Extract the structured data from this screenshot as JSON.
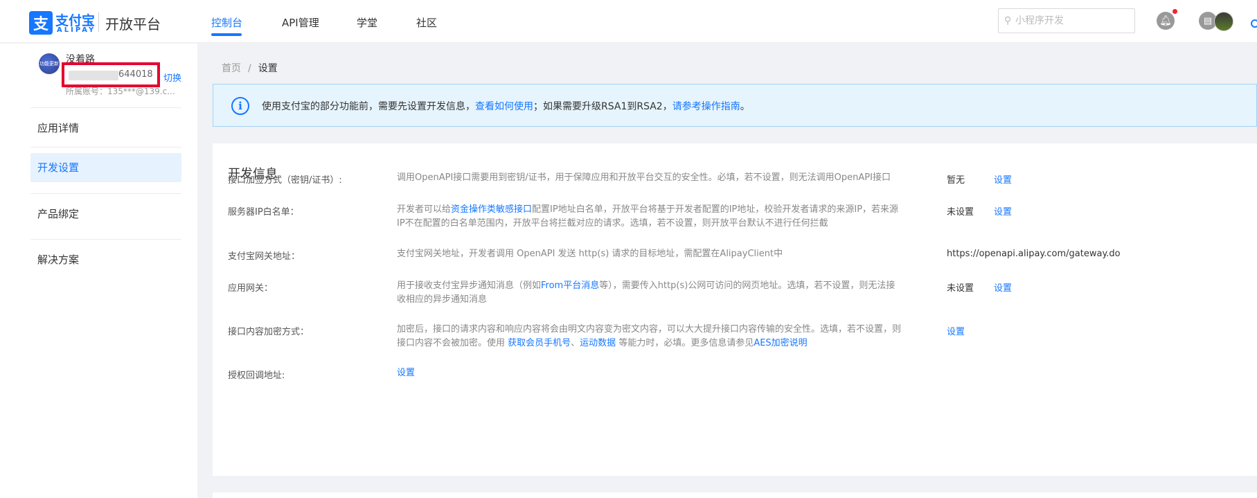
{
  "header": {
    "logo_glyph": "支",
    "logo_cn": "支付宝",
    "logo_en": "ALIPAY",
    "logo_sub": "开放平台",
    "tabs": [
      {
        "label": "控制台",
        "active": true
      },
      {
        "label": "API管理",
        "active": false
      },
      {
        "label": "学堂",
        "active": false
      },
      {
        "label": "社区",
        "active": false
      }
    ],
    "search": {
      "placeholder": "小程序开发",
      "value": ""
    },
    "accent_color": "#1677ff"
  },
  "sidebar": {
    "avatar_text": "功能更新",
    "app_name": "没着路",
    "app_id_suffix": "644018",
    "switch_label": "切换",
    "account_label": "所属账号：135***@139.c...",
    "items": [
      {
        "label": "应用详情",
        "active": false
      },
      {
        "label": "开发设置",
        "active": true
      },
      {
        "label": "产品绑定",
        "active": false
      },
      {
        "label": "解决方案",
        "active": false
      }
    ]
  },
  "breadcrumb": {
    "home": "首页",
    "separator": "/",
    "current": "设置"
  },
  "alert": {
    "icon": "i",
    "text1": "使用支付宝的部分功能前，需要先设置开发信息，",
    "link1": "查看如何使用",
    "text2": "；如果需要升级RSA1到RSA2，",
    "link2": "请参考操作指南",
    "text3": "。"
  },
  "dev_info": {
    "title": "开发信息",
    "rows": [
      {
        "label": "接口加签方式（密钥/证书）:",
        "desc": [
          "调用OpenAPI接口需要用到密钥/证书，用于保障应用和开放平台交互的安全性。必填，若不设置，则无法调用OpenAPI接口"
        ],
        "status": "暂无",
        "action": "设置"
      },
      {
        "label": "服务器IP白名单：",
        "desc": [
          "开发者可以给",
          "资金操作类敏感接口",
          "配置IP地址白名单，开放平台将基于开发者配置的IP地址，校验开发者请求的来源IP，若来源IP不在配置的白名单范围内，开放平台将拦截对应的请求。选填，若不设置，则开放平台默认不进行任何拦截"
        ],
        "status": "未设置",
        "action": "设置"
      },
      {
        "label": "支付宝网关地址：",
        "desc": [
          "支付宝网关地址，开发者调用 OpenAPI 发送 http(s) 请求的目标地址，需配置在AlipayClient中"
        ],
        "status": "https://openapi.alipay.com/gateway.do",
        "action": ""
      },
      {
        "label": "应用网关：",
        "desc": [
          "用于接收支付宝异步通知消息（例如",
          "From平台消息",
          "等），需要传入http(s)公网可访问的网页地址。选填，若不设置，则无法接收相应的异步通知消息"
        ],
        "status": "未设置",
        "action": "设置"
      },
      {
        "label": "接口内容加密方式：",
        "desc": [
          "加密后，接口的请求内容和响应内容将会由明文内容变为密文内容，可以大大提升接口内容传输的安全性。选填，若不设置，则接口内容不会被加密。使用 ",
          "获取会员手机号",
          "、",
          "运动数据",
          " 等能力时，必填。更多信息请参见",
          "AES加密说明"
        ],
        "status": "",
        "action": "设置"
      },
      {
        "label": "授权回调地址:",
        "desc": [],
        "status": "",
        "action": "设置"
      }
    ]
  }
}
